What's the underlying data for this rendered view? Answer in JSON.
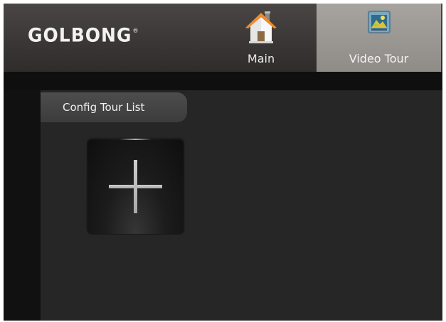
{
  "header": {
    "logo_text": "GOLBONG",
    "logo_mark": "®",
    "tabs": [
      {
        "label": "Main",
        "icon": "home-icon",
        "active": false
      },
      {
        "label": "Video Tour",
        "icon": "video-tour-icon",
        "active": true
      }
    ]
  },
  "panel": {
    "title": "Config Tour List",
    "add_button_icon": "plus-icon"
  },
  "colors": {
    "topbar": "#3a3736",
    "active_tab": "#9b9793",
    "background": "#141414",
    "content": "#262626",
    "panel_tab": "#454545",
    "plus": "#c9c9c9"
  }
}
